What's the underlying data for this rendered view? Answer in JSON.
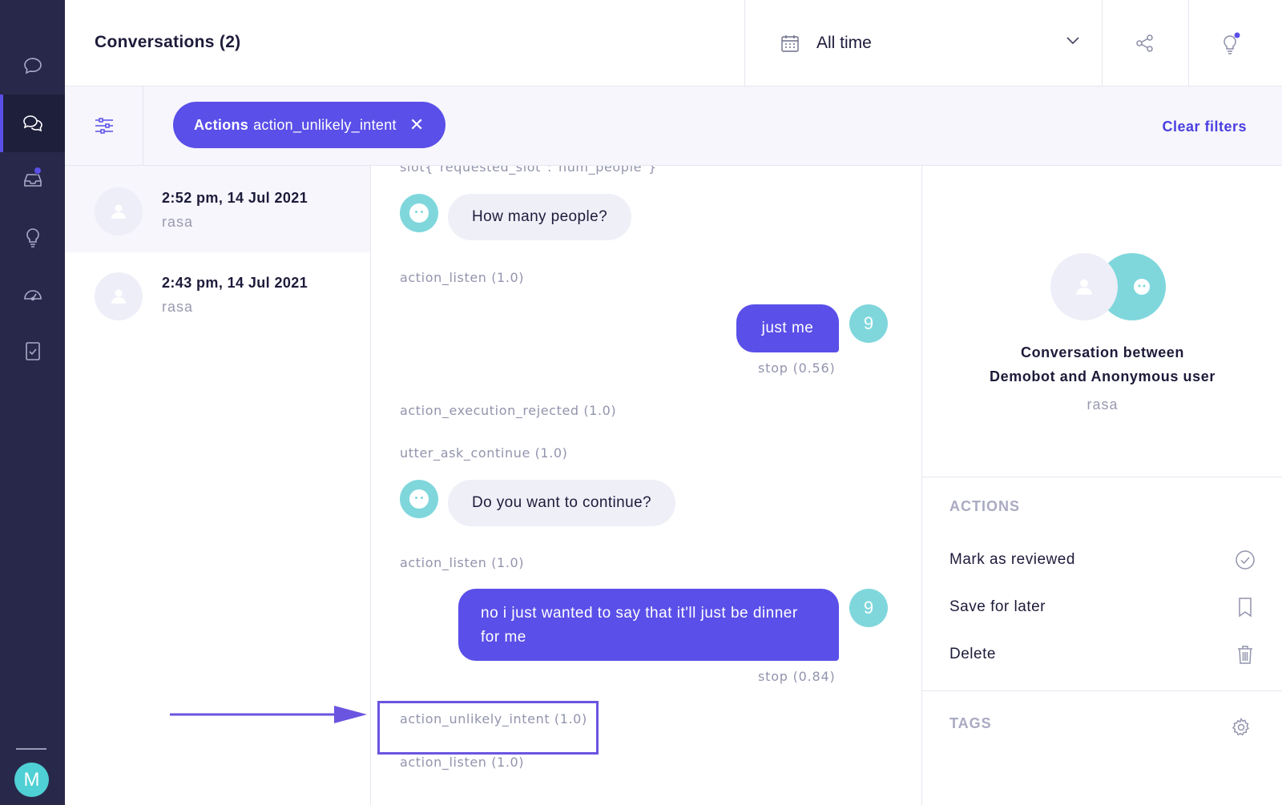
{
  "app": {
    "accent_color": "#5a4fe8",
    "rail_color": "#28294a",
    "avatar_color": "#4fd0d4"
  },
  "sidebar": {
    "items": [
      {
        "icon": "chat-bubble-icon"
      },
      {
        "icon": "conversations-icon",
        "active": true
      },
      {
        "icon": "inbox-icon",
        "badge": true
      },
      {
        "icon": "lightbulb-icon"
      },
      {
        "icon": "speedometer-icon"
      },
      {
        "icon": "checklist-icon"
      }
    ],
    "user_initial": "M"
  },
  "header": {
    "title": "Conversations (2)",
    "date_filter": "All time",
    "share_icon": "share-icon",
    "tips_icon": "lightbulb-notification-icon"
  },
  "filters": {
    "chip_key": "Actions",
    "chip_value": "action_unlikely_intent",
    "chip_close": "✕",
    "clear_label": "Clear filters"
  },
  "conversations": [
    {
      "time": "2:52 pm, 14 Jul 2021",
      "user": "rasa",
      "selected": true
    },
    {
      "time": "2:43 pm, 14 Jul 2021",
      "user": "rasa",
      "selected": false
    }
  ],
  "transcript": {
    "top_partial": "slot{\"requested_slot\":\"num_people\"}",
    "bot_msg_1": "How many people?",
    "event_1": "action_listen (1.0)",
    "user_msg_1": "just me",
    "user_avatar_1": "9",
    "intent_1": "stop (0.56)",
    "event_2": "action_execution_rejected (1.0)",
    "event_3": "utter_ask_continue (1.0)",
    "bot_msg_2": "Do you want to continue?",
    "event_4": "action_listen (1.0)",
    "user_msg_2": "no i just wanted to say that it'll just be dinner for me",
    "user_avatar_2": "9",
    "intent_2": "stop (0.84)",
    "event_5": "action_unlikely_intent (1.0)",
    "event_6": "action_listen (1.0)"
  },
  "details": {
    "title_line1": "Conversation between",
    "title_line2": "Demobot and Anonymous user",
    "user": "rasa",
    "actions_title": "ACTIONS",
    "actions": [
      {
        "label": "Mark as reviewed",
        "icon": "check-circle-icon"
      },
      {
        "label": "Save for later",
        "icon": "bookmark-icon"
      },
      {
        "label": "Delete",
        "icon": "trash-icon"
      }
    ],
    "tags_title": "TAGS"
  }
}
